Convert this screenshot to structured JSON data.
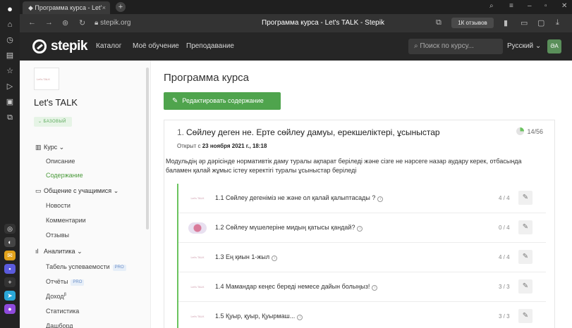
{
  "browser": {
    "tab_title": "Программа курса - Let'",
    "tab_close": "×",
    "new_tab": "+",
    "url": "stepik.org",
    "page_title": "Программа курса - Let's TALK - Stepik",
    "reviews_label": "1К отзывов"
  },
  "header": {
    "logo_text": "stepik",
    "nav": [
      "Каталог",
      "Моё обучение",
      "Преподавание"
    ],
    "search_placeholder": "Поиск по курсу...",
    "language": "Русский",
    "avatar_initials": "ӘА"
  },
  "sidebar": {
    "thumb_text": "Let's TALK",
    "course_title": "Let's TALK",
    "badge": "БАЗОВЫЙ",
    "sections": [
      {
        "label": "Курс",
        "items": [
          "Описание",
          "Содержание"
        ],
        "active_item": "Содержание"
      },
      {
        "label": "Общение с учащимися",
        "items": [
          "Новости",
          "Комментарии",
          "Отзывы"
        ]
      },
      {
        "label": "Аналитика",
        "items": [
          "Табель успеваемости",
          "Отчёты",
          "Доход",
          "Статистика",
          "Дашборд"
        ]
      }
    ],
    "pro_label": "PRO",
    "beta_mark": "β"
  },
  "main": {
    "page_title": "Программа курса",
    "edit_button": "Редактировать содержание",
    "module": {
      "number": "1.",
      "title": "Сөйлеу деген не. Ерте сөйлеу дамуы, ерекшеліктері, ұсыныстар",
      "progress": "14/56",
      "progress_fraction": 0.25,
      "opened_prefix": "Открыт с",
      "opened_date": "23 ноября 2021 г., 18:18",
      "description": "Модульдің әр дәрісінде нормативтік даму туралы ақпарат беріледі және сізге не нәрсеге назар аудару керек, отбасында баламен қалай жұмыс істеу керектігі туралы ұсыныстар беріледі",
      "lessons": [
        {
          "title": "1.1 Сөйлеу дегеніміз не және ол қалай қалыптасады ?",
          "score": "4 / 4",
          "thumb": "Let's TALK"
        },
        {
          "title": "1.2 Сөйлеу мүшелеріне мидың қатысы қандай?",
          "score": "0 / 4",
          "thumb": ""
        },
        {
          "title": "1.3 Ең қиын 1-жыл",
          "score": "4 / 4",
          "thumb": "Let's TALK"
        },
        {
          "title": "1.4 Мамандар кеңес береді немесе дайын болыңыз!",
          "score": "3 / 3",
          "thumb": "Let's TALK"
        },
        {
          "title": "1.5 Қуыр, қуыр, Қуырмаш...",
          "score": "3 / 3",
          "thumb": "Let's TALK"
        }
      ]
    }
  },
  "colors": {
    "accent_green": "#4fa44d",
    "lesson_border": "#6bc35f"
  }
}
